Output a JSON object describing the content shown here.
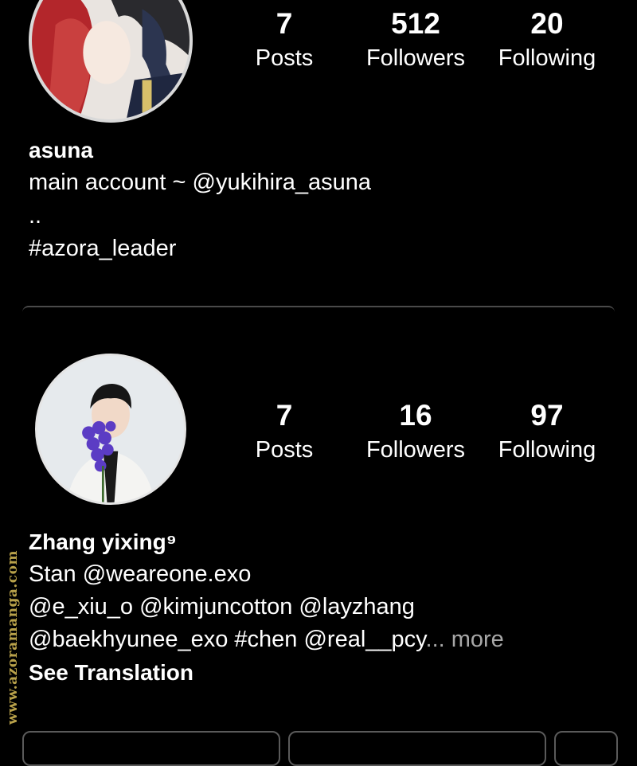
{
  "profile1": {
    "stats": {
      "posts": {
        "value": "7",
        "label": "Posts"
      },
      "followers": {
        "value": "512",
        "label": "Followers"
      },
      "following": {
        "value": "20",
        "label": "Following"
      }
    },
    "name": "asuna",
    "bio": [
      "main account ~ @yukihira_asuna",
      "..",
      "#azora_leader"
    ]
  },
  "profile2": {
    "stats": {
      "posts": {
        "value": "7",
        "label": "Posts"
      },
      "followers": {
        "value": "16",
        "label": "Followers"
      },
      "following": {
        "value": "97",
        "label": "Following"
      }
    },
    "name": "Zhang yixing⁹",
    "bio": [
      "Stan @weareone.exo",
      "@e_xiu_o @kimjuncotton @layzhang",
      "@baekhyunee_exo #chen @real__pcy"
    ],
    "more_label": "... more",
    "see_translation": "See Translation"
  },
  "watermark": "www.azoramanga.com",
  "colors": {
    "background": "#000000",
    "text": "#ffffff",
    "muted": "#a8a8a8",
    "watermark": "#b8a14a"
  }
}
